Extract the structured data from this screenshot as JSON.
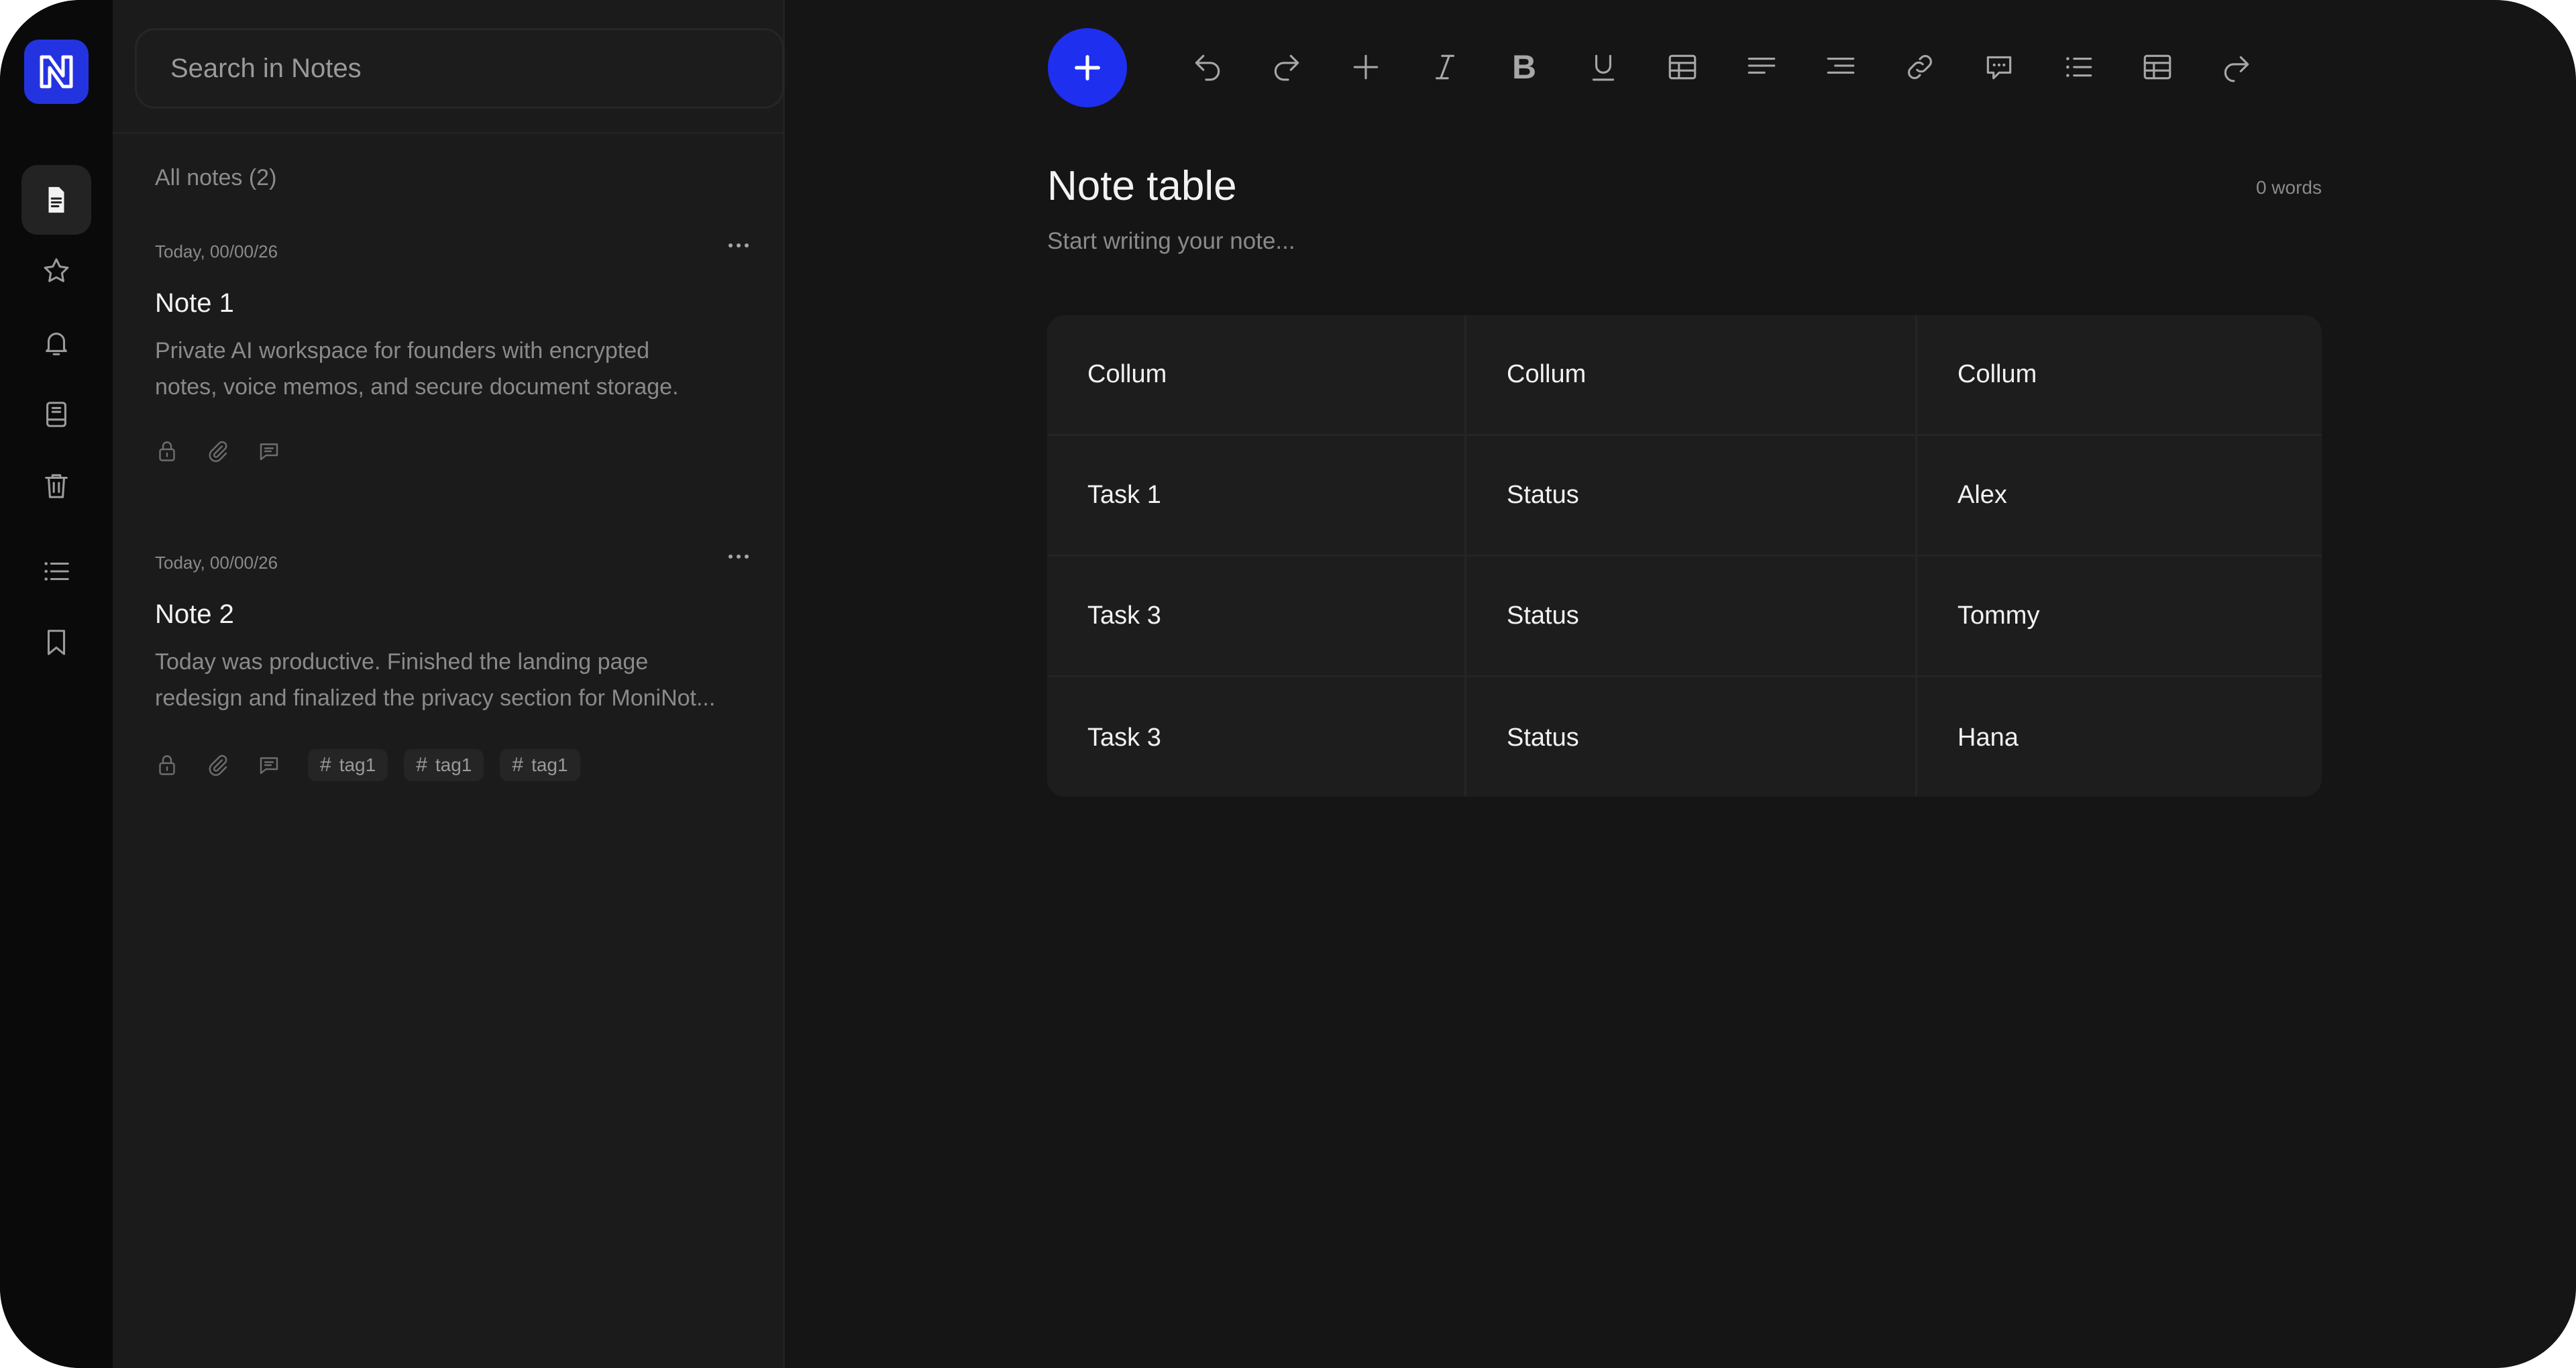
{
  "rail": {
    "items": [
      {
        "icon": "document-icon",
        "active": true
      },
      {
        "icon": "star-icon"
      },
      {
        "icon": "bell-icon"
      },
      {
        "icon": "notebook-icon"
      },
      {
        "icon": "trash-icon"
      },
      {
        "icon": "list-icon"
      },
      {
        "icon": "bookmark-icon"
      }
    ]
  },
  "search": {
    "placeholder": "Search in Notes"
  },
  "list": {
    "heading": "All notes (2)",
    "notes": [
      {
        "date": "Today, 00/00/26",
        "title": "Note 1",
        "preview_line1": "Private AI workspace for founders with encrypted",
        "preview_line2": "notes, voice memos, and secure document storage.",
        "tags": []
      },
      {
        "date": "Today, 00/00/26",
        "title": "Note 2",
        "preview_line1": "Today was productive. Finished the landing page",
        "preview_line2": "redesign and finalized the privacy section for MoniNot...",
        "tags": [
          "tag1",
          "tag1",
          "tag1"
        ]
      }
    ]
  },
  "toolbar": {
    "tools": [
      "undo-icon",
      "redo-icon",
      "plus-icon",
      "italic-icon",
      "bold-icon",
      "underline-icon",
      "table-icon",
      "align-left-icon",
      "align-right-icon",
      "link-icon",
      "comment-icon",
      "bullet-list-icon",
      "table-icon",
      "forward-icon"
    ],
    "bold_label": "B"
  },
  "editor": {
    "title": "Note table",
    "word_count": "0 words",
    "placeholder": "Start writing your note...",
    "table": {
      "header": [
        "Collum",
        "Collum",
        "Collum"
      ],
      "rows": [
        [
          "Task 1",
          "Status",
          "Alex"
        ],
        [
          "Task 3",
          "Status",
          "Tommy"
        ],
        [
          "Task 3",
          "Status",
          "Hana"
        ]
      ]
    }
  },
  "colors": {
    "accent": "#1f2ff0",
    "background": "#151515",
    "panel": "#1b1b1b",
    "rail": "#0a0a0a"
  }
}
